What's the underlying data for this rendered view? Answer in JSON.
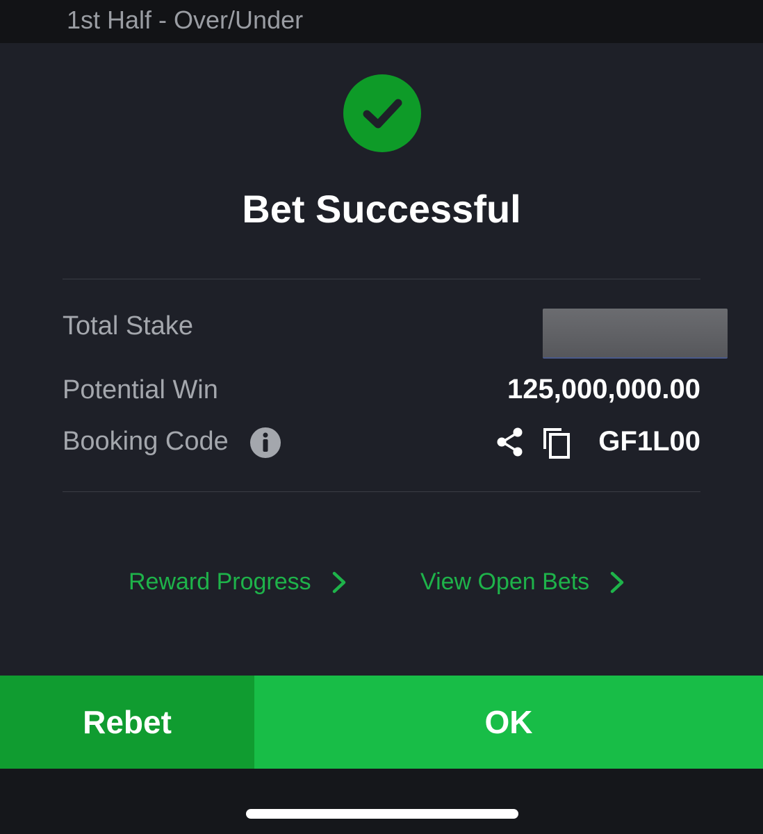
{
  "header": {
    "market_title": "1st Half - Over/Under"
  },
  "modal": {
    "status_icon": "check-circle-icon",
    "title": "Bet Successful",
    "rows": {
      "total_stake": {
        "label": "Total Stake",
        "value_redacted": true
      },
      "potential_win": {
        "label": "Potential Win",
        "value": "125,000,000.00"
      },
      "booking_code": {
        "label": "Booking Code",
        "info_icon": "info-icon",
        "share_icon": "share-icon",
        "copy_icon": "copy-icon",
        "value": "GF1L00"
      }
    },
    "links": {
      "reward_progress": "Reward Progress",
      "view_open_bets": "View Open Bets"
    }
  },
  "buttons": {
    "rebet": "Rebet",
    "ok": "OK"
  },
  "colors": {
    "success_green": "#0e9b28",
    "link_green": "#1eb34a",
    "rebet_green": "#109c30",
    "ok_green": "#18bd47",
    "modal_bg": "#1e2028"
  }
}
